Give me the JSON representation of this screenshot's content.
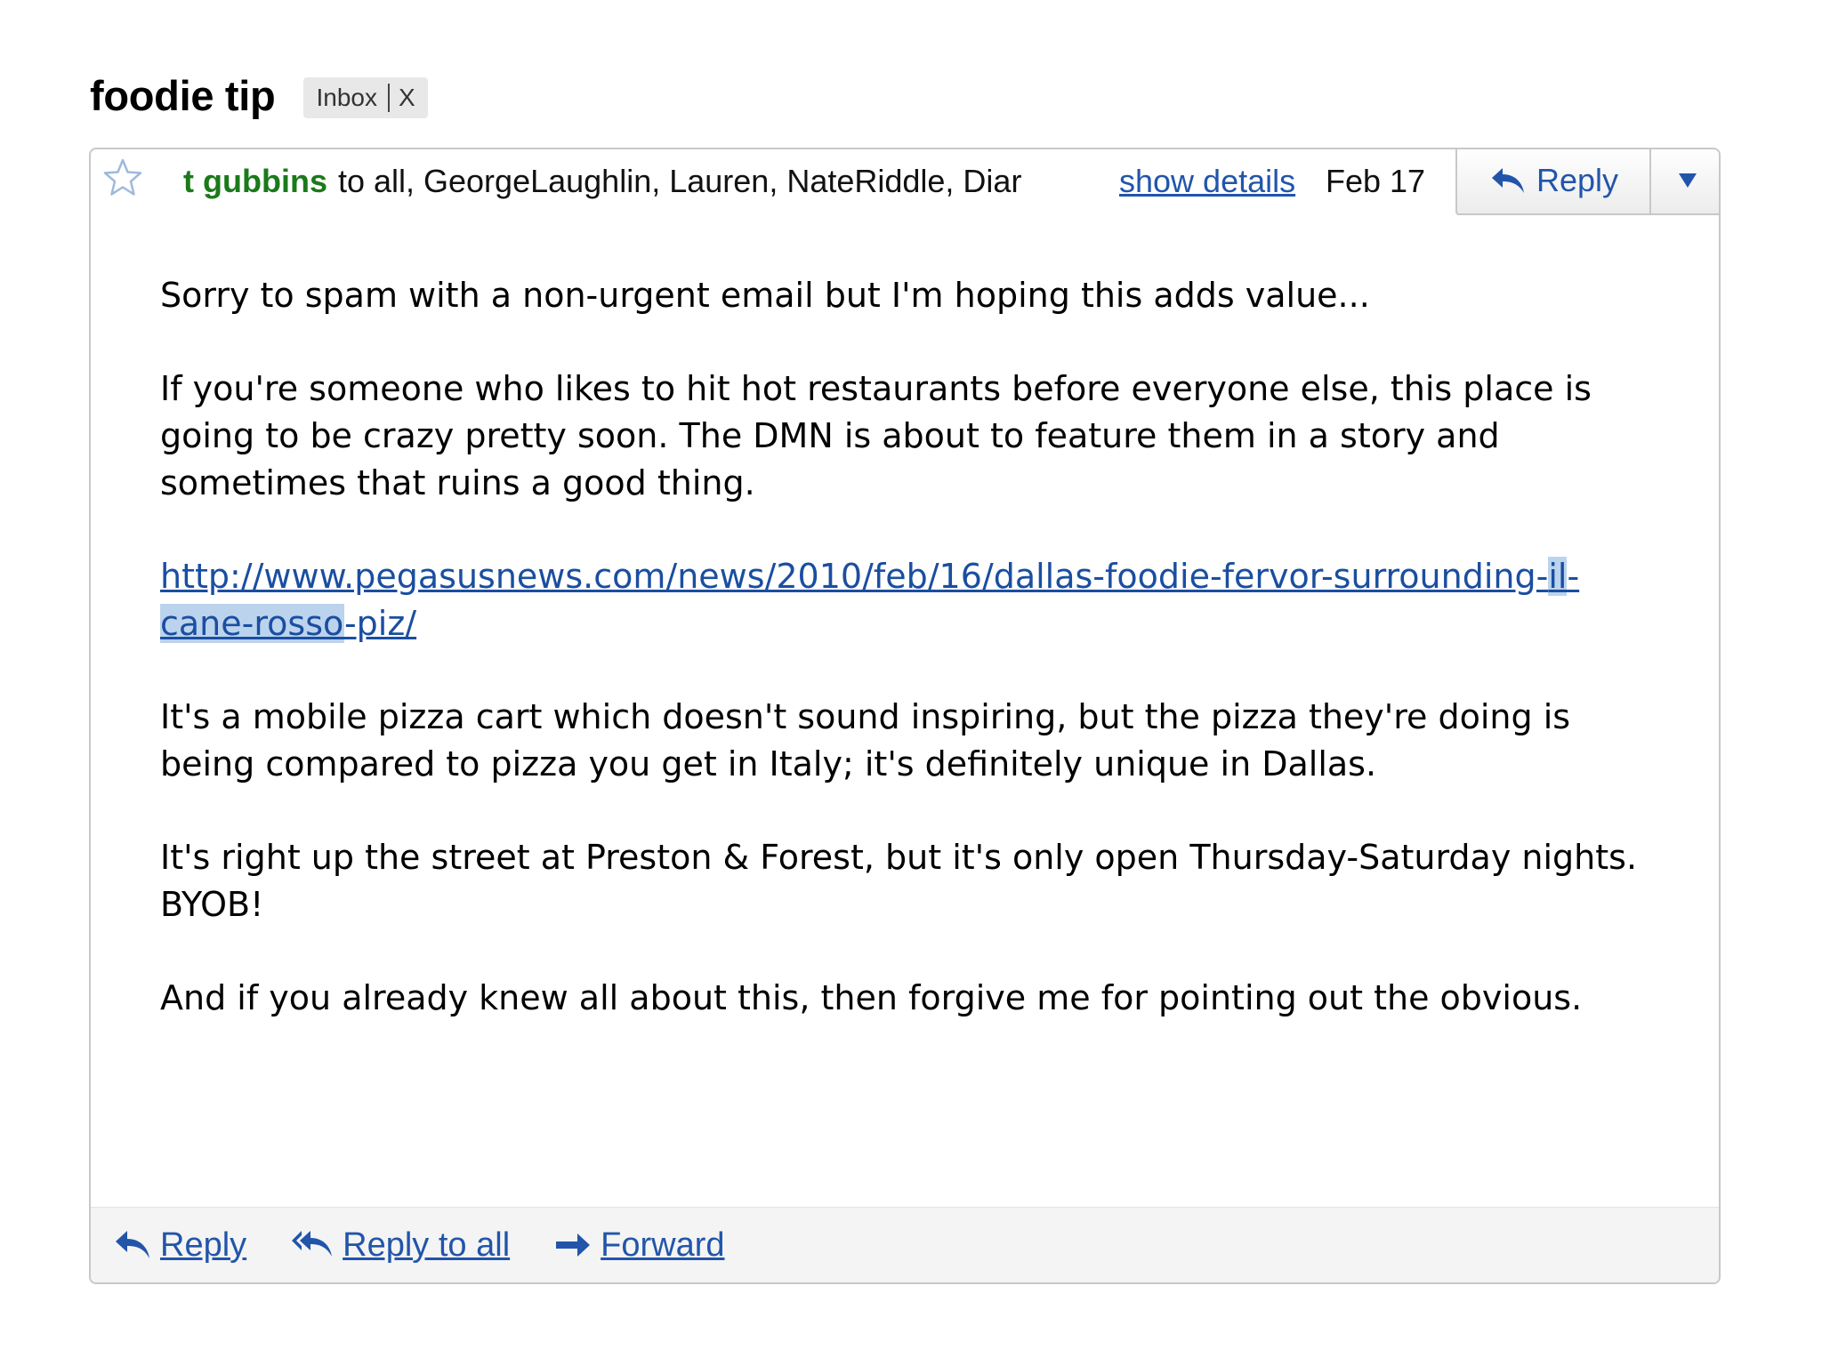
{
  "thread": {
    "subject": "foodie tip",
    "label": "Inbox",
    "label_remove": "X"
  },
  "message": {
    "sender": "t gubbins",
    "recipients": "to all, GeorgeLaughlin, Lauren, NateRiddle, Diar",
    "show_details": "show details",
    "date": "Feb 17",
    "reply_label": "Reply",
    "body": {
      "p1": "Sorry to spam with a non-urgent email but I'm hoping this adds value...",
      "p2": "If you're someone who likes to hit hot restaurants before everyone else, this place is going to be crazy pretty soon. The DMN is about to feature them in a story and sometimes that ruins a good thing.",
      "link_part1": "http://www.pegasusnews.com/news/2010/feb/16/dallas-foodie-fervor-surrounding-",
      "link_highlight1": "il",
      "link_part2": "-",
      "link_highlight2": "cane-rosso",
      "link_part3": "-piz/",
      "p4": "It's a mobile pizza cart which doesn't sound inspiring, but the pizza they're doing is being compared to pizza you get in Italy; it's definitely unique in Dallas.",
      "p5": "It's right up the street at Preston & Forest, but it's only open Thursday-Saturday nights. BYOB!",
      "p6": "And if you already knew all about this, then forgive me for pointing out the obvious."
    }
  },
  "footer": {
    "reply": "Reply",
    "reply_all": "Reply to all",
    "forward": "Forward"
  },
  "icons": {
    "star": "star-icon",
    "reply": "reply-arrow-icon",
    "reply_all": "reply-all-icon",
    "forward": "forward-arrow-icon",
    "dropdown": "triangle-down-icon"
  },
  "colors": {
    "sender": "#1a7a1a",
    "link": "#2255aa",
    "highlight": "#bcd3ee"
  }
}
